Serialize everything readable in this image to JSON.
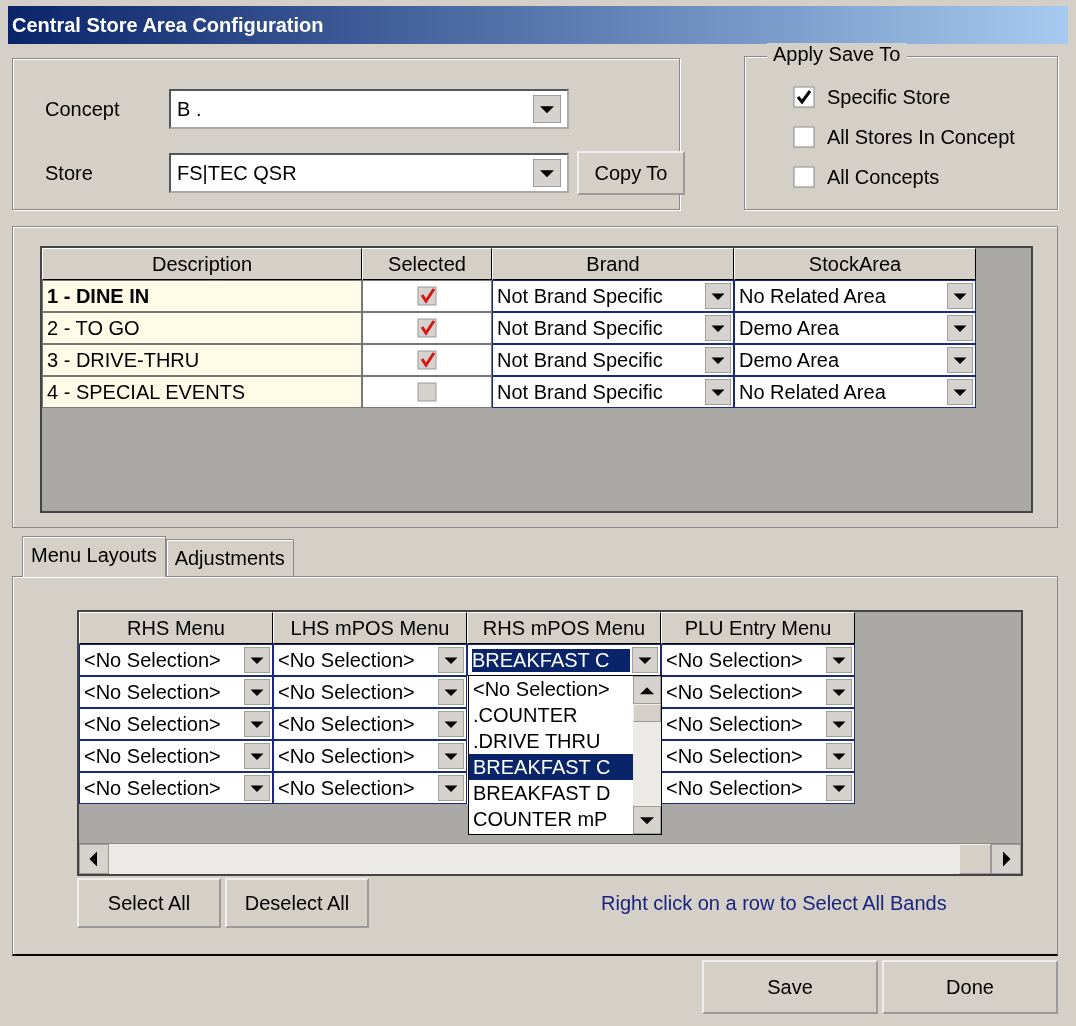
{
  "window": {
    "title": "Central Store Area Configuration"
  },
  "store_group": {
    "concept": {
      "label": "Concept",
      "value": "B ."
    },
    "store": {
      "label": "Store",
      "value": "FS|TEC QSR"
    },
    "copy_button": "Copy To"
  },
  "apply_save_to": {
    "title": "Apply Save To",
    "options": [
      {
        "label": "Specific Store",
        "checked": true
      },
      {
        "label": "All Stores In Concept",
        "checked": false
      },
      {
        "label": "All Concepts",
        "checked": false
      }
    ]
  },
  "areas_table": {
    "columns": [
      "Description",
      "Selected",
      "Brand",
      "StockArea"
    ],
    "rows": [
      {
        "description": "1 - DINE IN",
        "bold": true,
        "selected": true,
        "brand": "Not Brand Specific",
        "stock_area": "No Related Area"
      },
      {
        "description": "2 - TO GO",
        "bold": false,
        "selected": true,
        "brand": "Not Brand Specific",
        "stock_area": "Demo Area"
      },
      {
        "description": "3 - DRIVE-THRU",
        "bold": false,
        "selected": true,
        "brand": "Not Brand Specific",
        "stock_area": "Demo Area"
      },
      {
        "description": "4 - SPECIAL EVENTS",
        "bold": false,
        "selected": false,
        "brand": "Not Brand Specific",
        "stock_area": "No Related Area"
      }
    ]
  },
  "tabs": [
    {
      "label": "Menu Layouts",
      "selected": true
    },
    {
      "label": "Adjustments",
      "selected": false
    }
  ],
  "menu_grid": {
    "columns": [
      "RHS Menu",
      "LHS mPOS Menu",
      "RHS mPOS Menu",
      "PLU Entry Menu"
    ],
    "rows": [
      {
        "cells": [
          {
            "value": "<No Selection>",
            "focused": false
          },
          {
            "value": "<No Selection>",
            "focused": false
          },
          {
            "value": "BREAKFAST C",
            "focused": true
          },
          {
            "value": "<No Selection>",
            "focused": false
          }
        ]
      },
      {
        "cells": [
          {
            "value": "<No Selection>",
            "focused": false
          },
          {
            "value": "<No Selection>",
            "focused": false
          },
          null,
          {
            "value": "<No Selection>",
            "focused": false
          }
        ]
      },
      {
        "cells": [
          {
            "value": "<No Selection>",
            "focused": false
          },
          {
            "value": "<No Selection>",
            "focused": false
          },
          null,
          {
            "value": "<No Selection>",
            "focused": false
          }
        ]
      },
      {
        "cells": [
          {
            "value": "<No Selection>",
            "focused": false
          },
          {
            "value": "<No Selection>",
            "focused": false
          },
          null,
          {
            "value": "<No Selection>",
            "focused": false
          }
        ]
      },
      {
        "cells": [
          {
            "value": "<No Selection>",
            "focused": false
          },
          {
            "value": "<No Selection>",
            "focused": false
          },
          null,
          {
            "value": "<No Selection>",
            "focused": false
          }
        ]
      }
    ],
    "open_dropdown": {
      "items": [
        {
          "label": "<No Selection>",
          "selected": false
        },
        {
          "label": ".COUNTER",
          "selected": false
        },
        {
          "label": ".DRIVE THRU",
          "selected": false
        },
        {
          "label": "BREAKFAST C",
          "selected": true
        },
        {
          "label": "BREAKFAST D",
          "selected": false
        },
        {
          "label": "COUNTER mP",
          "selected": false
        }
      ]
    }
  },
  "grid_buttons": [
    "Select All",
    "Deselect All"
  ],
  "hint": "Right click on a row to Select All Bands",
  "footer_buttons": [
    "Save",
    "Done"
  ]
}
